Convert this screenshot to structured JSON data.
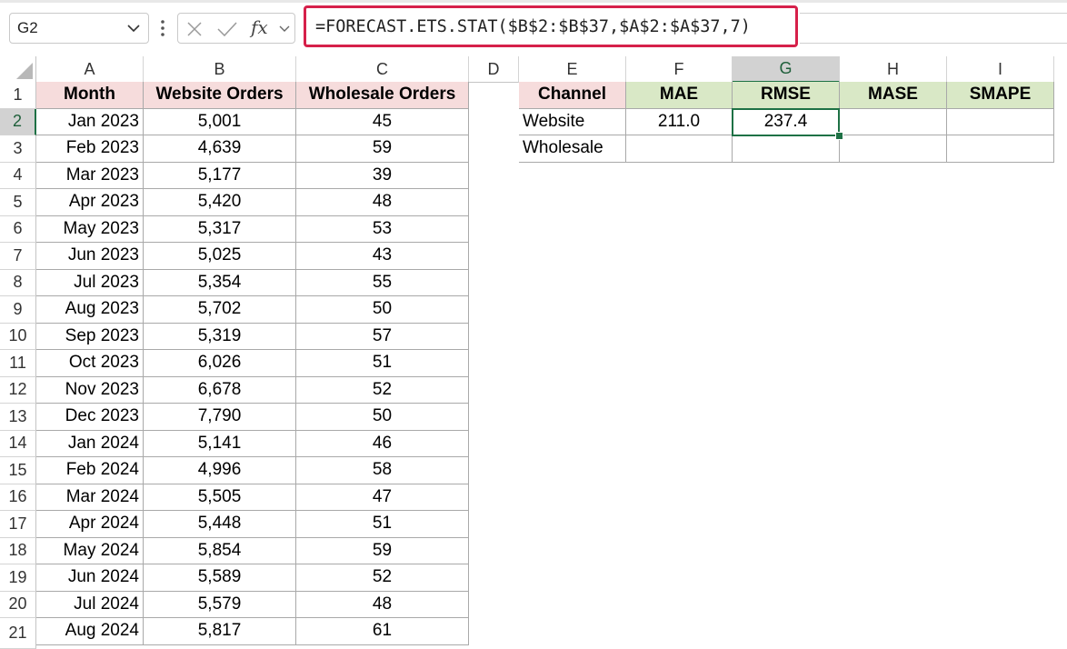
{
  "formula_bar": {
    "name_box": "G2",
    "fx_label": "fx",
    "formula": "=FORECAST.ETS.STAT($B$2:$B$37,$A$2:$A$37,7)"
  },
  "columns": [
    "A",
    "B",
    "C",
    "D",
    "E",
    "F",
    "G",
    "H",
    "I"
  ],
  "active_cell": {
    "column": "G",
    "row": 2
  },
  "main_table": {
    "headers": [
      "Month",
      "Website Orders",
      "Wholesale Orders"
    ],
    "rows": [
      [
        "Jan 2023",
        "5,001",
        "45"
      ],
      [
        "Feb 2023",
        "4,639",
        "59"
      ],
      [
        "Mar 2023",
        "5,177",
        "39"
      ],
      [
        "Apr 2023",
        "5,420",
        "48"
      ],
      [
        "May 2023",
        "5,317",
        "53"
      ],
      [
        "Jun 2023",
        "5,025",
        "43"
      ],
      [
        "Jul 2023",
        "5,354",
        "55"
      ],
      [
        "Aug 2023",
        "5,702",
        "50"
      ],
      [
        "Sep 2023",
        "5,319",
        "57"
      ],
      [
        "Oct 2023",
        "6,026",
        "51"
      ],
      [
        "Nov 2023",
        "6,678",
        "52"
      ],
      [
        "Dec 2023",
        "7,790",
        "50"
      ],
      [
        "Jan 2024",
        "5,141",
        "46"
      ],
      [
        "Feb 2024",
        "4,996",
        "58"
      ],
      [
        "Mar 2024",
        "5,505",
        "47"
      ],
      [
        "Apr 2024",
        "5,448",
        "51"
      ],
      [
        "May 2024",
        "5,854",
        "59"
      ],
      [
        "Jun 2024",
        "5,589",
        "52"
      ],
      [
        "Jul 2024",
        "5,579",
        "48"
      ],
      [
        "Aug 2024",
        "5,817",
        "61"
      ]
    ]
  },
  "stats_table": {
    "headers": [
      "Channel",
      "MAE",
      "RMSE",
      "MASE",
      "SMAPE"
    ],
    "rows": [
      [
        "Website",
        "211.0",
        "237.4",
        "",
        ""
      ],
      [
        "Wholesale",
        "",
        "",
        "",
        ""
      ]
    ]
  },
  "colors": {
    "header_pink": "#f6dcdc",
    "header_green": "#d9e8c6",
    "selection_green": "#1e7145",
    "formula_highlight": "#d6204a"
  }
}
